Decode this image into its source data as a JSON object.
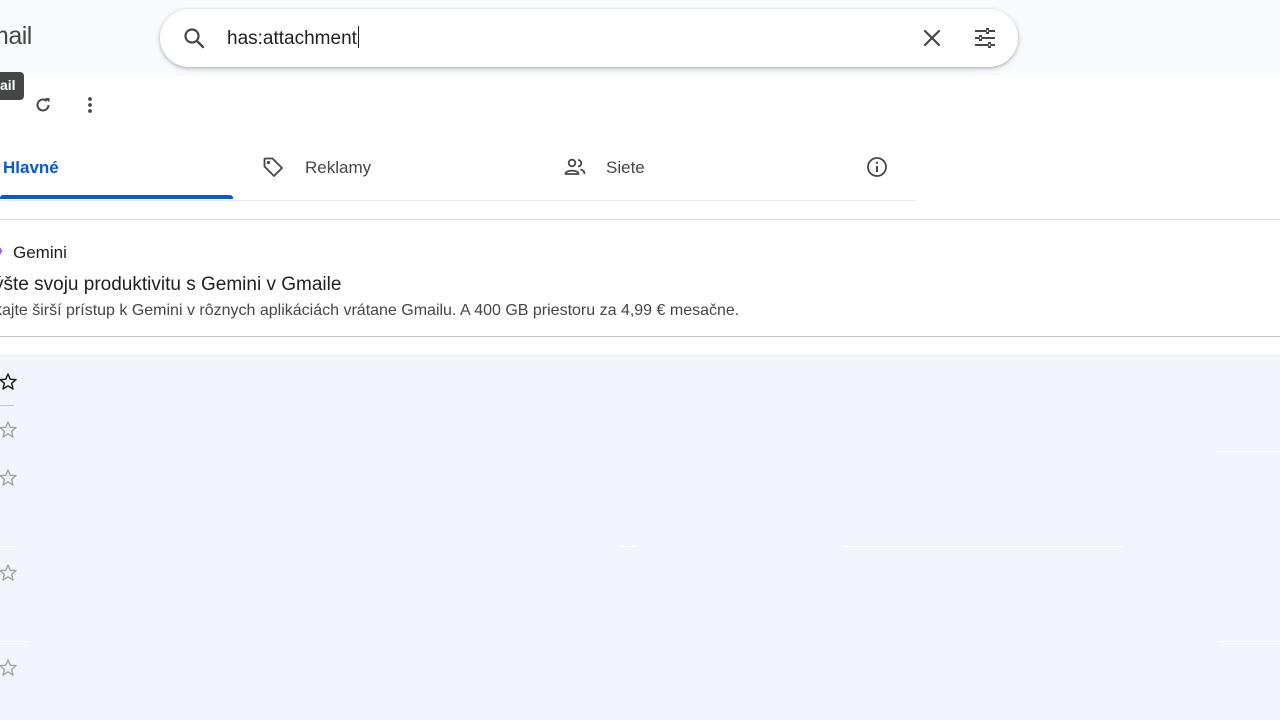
{
  "app": {
    "brand_text": "mail"
  },
  "search": {
    "query": "has:attachment"
  },
  "toolbar": {
    "tooltip": "ail"
  },
  "tabs": [
    {
      "label": "Hlavné",
      "selected": true
    },
    {
      "label": "Reklamy",
      "selected": false
    },
    {
      "label": "Siete",
      "selected": false
    }
  ],
  "promo": {
    "sender": "Gemini",
    "subject": "ýšte svoju produktivitu s Gemini v Gmaile",
    "snippet": "kajte širší prístup k Gemini v rôznych aplikáciách vrátane Gmailu. A 400 GB priestoru za 4,99 € mesačne."
  },
  "colors": {
    "accent": "#0b57d0",
    "list_bg": "#f2f6fc",
    "topbar_bg": "#f8fafd",
    "tooltip_bg": "#444746"
  },
  "icons": {
    "search": "search-icon",
    "clear": "close-icon",
    "filters": "tune-icon",
    "refresh": "refresh-icon",
    "more": "more-vert-icon",
    "promotions": "tag-icon",
    "social": "people-icon",
    "info": "info-icon",
    "star": "star-outline-icon"
  }
}
